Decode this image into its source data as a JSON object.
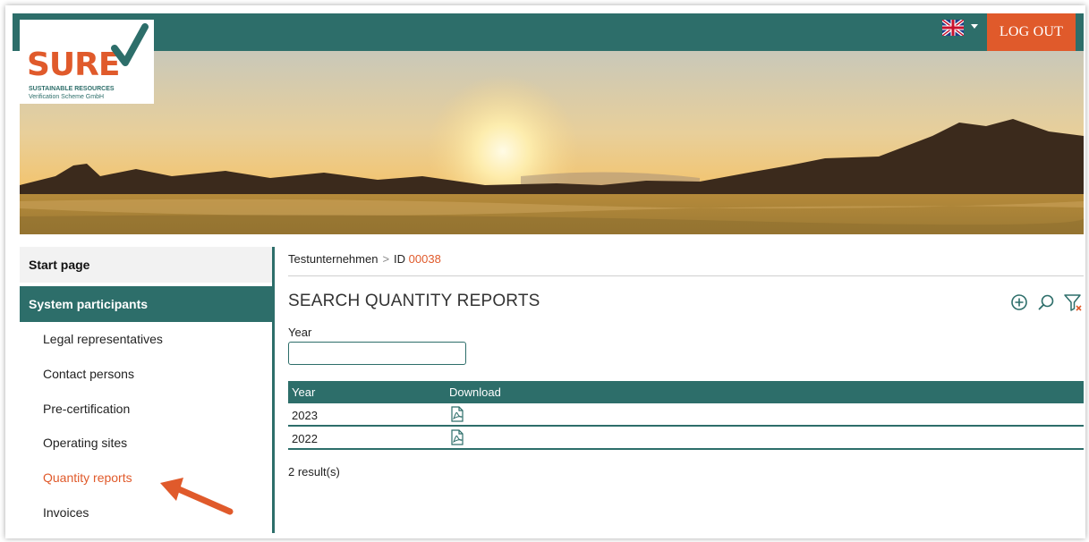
{
  "header": {
    "logo": {
      "word": "SURE",
      "line1": "SUSTAINABLE RESOURCES",
      "line2": "Verification Scheme GmbH"
    },
    "language_icon": "uk-flag-icon",
    "logout_label": "LOG OUT"
  },
  "sidebar": {
    "start_page": "Start page",
    "section": "System participants",
    "items": [
      {
        "label": "Legal representatives",
        "active": false
      },
      {
        "label": "Contact persons",
        "active": false
      },
      {
        "label": "Pre-certification",
        "active": false
      },
      {
        "label": "Operating sites",
        "active": false
      },
      {
        "label": "Quantity reports",
        "active": true
      },
      {
        "label": "Invoices",
        "active": false
      }
    ]
  },
  "breadcrumb": {
    "company": "Testunternehmen",
    "separator": ">",
    "id_label": "ID",
    "id_value": "00038"
  },
  "main": {
    "title": "SEARCH QUANTITY REPORTS",
    "tools": [
      "add-circle-icon",
      "search-icon",
      "filter-clear-icon"
    ],
    "year_label": "Year",
    "year_value": "",
    "table": {
      "headers": [
        "Year",
        "Download"
      ],
      "rows": [
        {
          "year": "2023",
          "download_icon": "pdf-document-icon"
        },
        {
          "year": "2022",
          "download_icon": "pdf-document-icon"
        }
      ]
    },
    "results_text": "2 result(s)"
  },
  "colors": {
    "teal": "#2d6e6a",
    "accent_orange": "#e05a2b"
  }
}
